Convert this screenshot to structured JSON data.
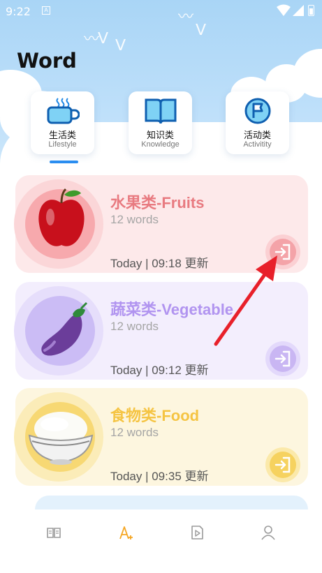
{
  "status_bar": {
    "time": "9:22",
    "notification_letter": "A"
  },
  "header": {
    "title": "Word"
  },
  "categories": [
    {
      "zh": "生活类",
      "en": "Lifestyle",
      "icon": "cup-icon",
      "selected": true
    },
    {
      "zh": "知识类",
      "en": "Knowledge",
      "icon": "book-icon",
      "selected": false
    },
    {
      "zh": "活动类",
      "en": "Activitity",
      "icon": "flag-icon",
      "selected": false
    }
  ],
  "cards": [
    {
      "title": "水果类-Fruits",
      "count": "12 words",
      "updated": "Today | 09:18 更新",
      "image": "apple-icon",
      "bg": "#fde9ea",
      "accent": "#e87a80"
    },
    {
      "title": "蔬菜类-Vegetable",
      "count": "12 words",
      "updated": "Today | 09:12 更新",
      "image": "eggplant-icon",
      "bg": "#f1ecfd",
      "accent": "#b194f0"
    },
    {
      "title": "食物类-Food",
      "count": "12 words",
      "updated": "Today | 09:35 更新",
      "image": "rice-bowl-icon",
      "bg": "#fdf6df",
      "accent": "#f5c443"
    }
  ],
  "bottom_nav": [
    {
      "icon": "book-open-icon",
      "active": false
    },
    {
      "icon": "word-add-icon",
      "active": true
    },
    {
      "icon": "video-icon",
      "active": false
    },
    {
      "icon": "profile-icon",
      "active": false
    }
  ],
  "colors": {
    "tab_blue": "#2a8df0",
    "nav_active": "#f5a623",
    "arrow": "#e8202a"
  }
}
